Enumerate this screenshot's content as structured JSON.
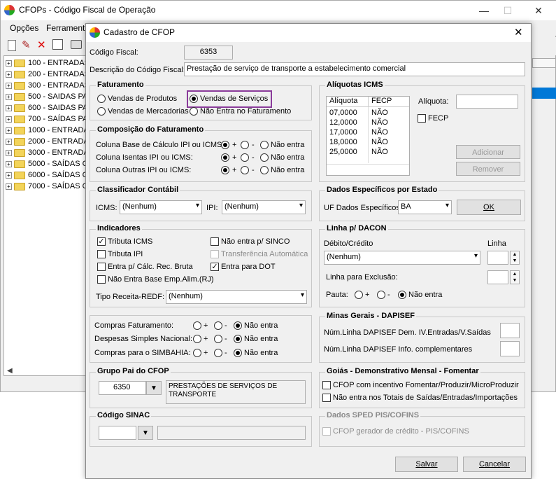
{
  "main": {
    "title": "CFOPs - Código Fiscal de Operação",
    "menu": [
      "Opções",
      "Ferramentas"
    ],
    "tree": [
      "100 - ENTRADAS",
      "200 - ENTRADAS",
      "300 - ENTRADAS",
      "500 - SAIDAS PA",
      "600 - SAIDAS PA",
      "700 - SAÍDAS PA",
      "1000 - ENTRADA",
      "2000 - ENTRADA",
      "3000 - ENTRADA",
      "5000 - SAÍDAS C",
      "6000 - SAÍDAS C",
      "7000 - SAÍDAS C"
    ]
  },
  "dialog": {
    "title": "Cadastro de CFOP",
    "codigo_label": "Código Fiscal:",
    "codigo_value": "6353",
    "desc_label": "Descrição do Código Fiscal:",
    "desc_value": "Prestação de serviço de transporte a estabelecimento comercial",
    "fat": {
      "title": "Faturamento",
      "produtos": "Vendas de Produtos",
      "servicos": "Vendas de Serviços",
      "mercadorias": "Vendas de Mercadorias",
      "nao_entra": "Não Entra no Faturamento"
    },
    "comp": {
      "title": "Composição do Faturamento",
      "rows": [
        "Coluna Base de Cálculo IPI ou ICMS:",
        "Coluna Isentas IPI ou ICMS:",
        "Coluna Outras IPI ou ICMS:"
      ],
      "plus": "+",
      "minus": "-",
      "nao": "Não entra"
    },
    "aliq": {
      "title": "Alíquotas ICMS",
      "col1": "Alíquota",
      "col2": "FECP",
      "rows": [
        [
          "07,0000",
          "NÃO"
        ],
        [
          "12,0000",
          "NÃO"
        ],
        [
          "17,0000",
          "NÃO"
        ],
        [
          "18,0000",
          "NÃO"
        ],
        [
          "25,0000",
          "NÃO"
        ]
      ],
      "aliq_label": "Alíquota:",
      "fecp_label": "FECP",
      "adicionar": "Adicionar",
      "remover": "Remover"
    },
    "class": {
      "title": "Classificador Contábil",
      "icms_label": "ICMS:",
      "icms_value": "(Nenhum)",
      "ipi_label": "IPI:",
      "ipi_value": "(Nenhum)"
    },
    "estado": {
      "title": "Dados Específicos por Estado",
      "uf_label": "UF Dados Específicos:",
      "uf_value": "BA",
      "ok": "OK"
    },
    "ind": {
      "title": "Indicadores",
      "tributa_icms": "Tributa ICMS",
      "tributa_ipi": "Tributa IPI",
      "entra_calc": "Entra p/ Cálc. Rec. Bruta",
      "nao_entra_base": "Não Entra Base Emp.Alim.(RJ)",
      "nao_sinco": "Não entra p/ SINCO",
      "transf": "Transferência Automática",
      "entra_dot": "Entra para DOT",
      "tipo_label": "Tipo Receita-REDF:",
      "tipo_value": "(Nenhum)"
    },
    "dacon": {
      "title": "Linha p/ DACON",
      "debito_label": "Débito/Crédito",
      "linha_label": "Linha",
      "debito_value": "(Nenhum)",
      "exclusao_label": "Linha para Exclusão:",
      "pauta_label": "Pauta:",
      "plus": "+",
      "minus": "-",
      "nao": "Não entra"
    },
    "compras": {
      "rows": [
        "Compras Faturamento:",
        "Despesas Simples Nacional:",
        "Compras para o SIMBAHIA:"
      ],
      "plus": "+",
      "minus": "-",
      "nao": "Não entra"
    },
    "minas": {
      "title": "Minas Gerais - DAPISEF",
      "row1": "Núm.Linha DAPISEF Dem. IV.Entradas/V.Saídas",
      "row2": "Núm.Linha DAPISEF Info. complementares"
    },
    "grupo": {
      "title": "Grupo Pai do CFOP",
      "value": "6350",
      "desc": "PRESTAÇÕES DE SERVIÇOS DE TRANSPORTE"
    },
    "goias": {
      "title": "Goiás - Demonstrativo Mensal - Fomentar",
      "row1": "CFOP com incentivo  Fomentar/Produzir/MicroProduzir",
      "row2": "Não entra nos Totais de  Saídas/Entradas/Importações"
    },
    "sinac": {
      "title": "Código SINAC"
    },
    "sped": {
      "title": "Dados SPED PIS/COFINS",
      "row1": "CFOP gerador de crédito - PIS/COFINS"
    },
    "salvar": "Salvar",
    "cancelar": "Cancelar"
  }
}
